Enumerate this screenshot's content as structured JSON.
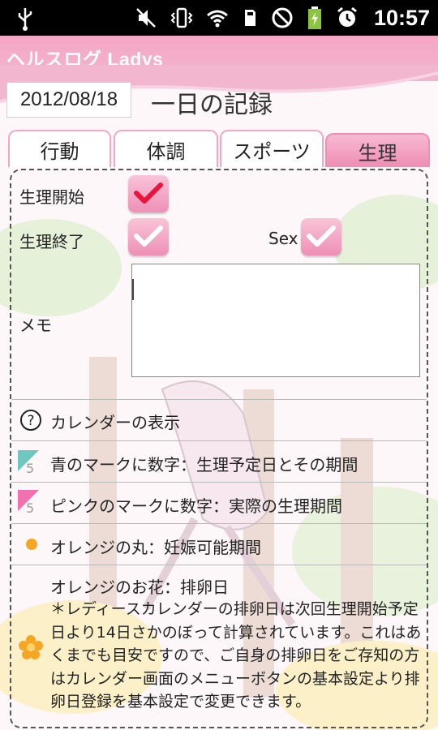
{
  "status": {
    "icons": [
      "usb-icon",
      "mute-icon",
      "vibrate-icon",
      "wifi-icon",
      "sd-card-icon",
      "no-signal-icon",
      "battery-charging-icon",
      "alarm-icon"
    ],
    "time": "10:57"
  },
  "app": {
    "title": "ヘルスログ Ladys"
  },
  "header": {
    "date": "2012/08/18",
    "page_title": "一日の記録"
  },
  "tabs": [
    {
      "label": "行動",
      "active": false
    },
    {
      "label": "体調",
      "active": false
    },
    {
      "label": "スポーツ",
      "active": false
    },
    {
      "label": "生理",
      "active": true
    }
  ],
  "form": {
    "period_start_label": "生理開始",
    "period_start_checked": true,
    "period_end_label": "生理終了",
    "period_end_checked": false,
    "sex_label": "Sex",
    "sex_checked": false,
    "memo_label": "メモ",
    "memo_value": ""
  },
  "legend": {
    "header": "カレンダーの表示",
    "items": [
      {
        "icon": "blue-mark-icon",
        "marker": "5",
        "text": "青のマークに数字：生理予定日とその期間",
        "color": "#6fc8c0"
      },
      {
        "icon": "pink-mark-icon",
        "marker": "5",
        "text": "ピンクのマークに数字：実際の生理期間",
        "color": "#f070b0"
      },
      {
        "icon": "orange-circle-icon",
        "text": "オレンジの丸：妊娠可能期間",
        "color": "#f5a623"
      }
    ],
    "flower_title": "オレンジのお花：排卵日",
    "flower_note": "＊レディースカレンダーの排卵日は次回生理開始予定日より14日さかのぼって計算されています。これはあくまでも目安ですので、ご自身の排卵日をご存知の方はカレンダー画面のメニューボタンの基本設定より排卵日登録を基本設定で変更できます。"
  },
  "colors": {
    "accent_pink": "#ef8db4",
    "titlebar": "#f6a6c5"
  }
}
